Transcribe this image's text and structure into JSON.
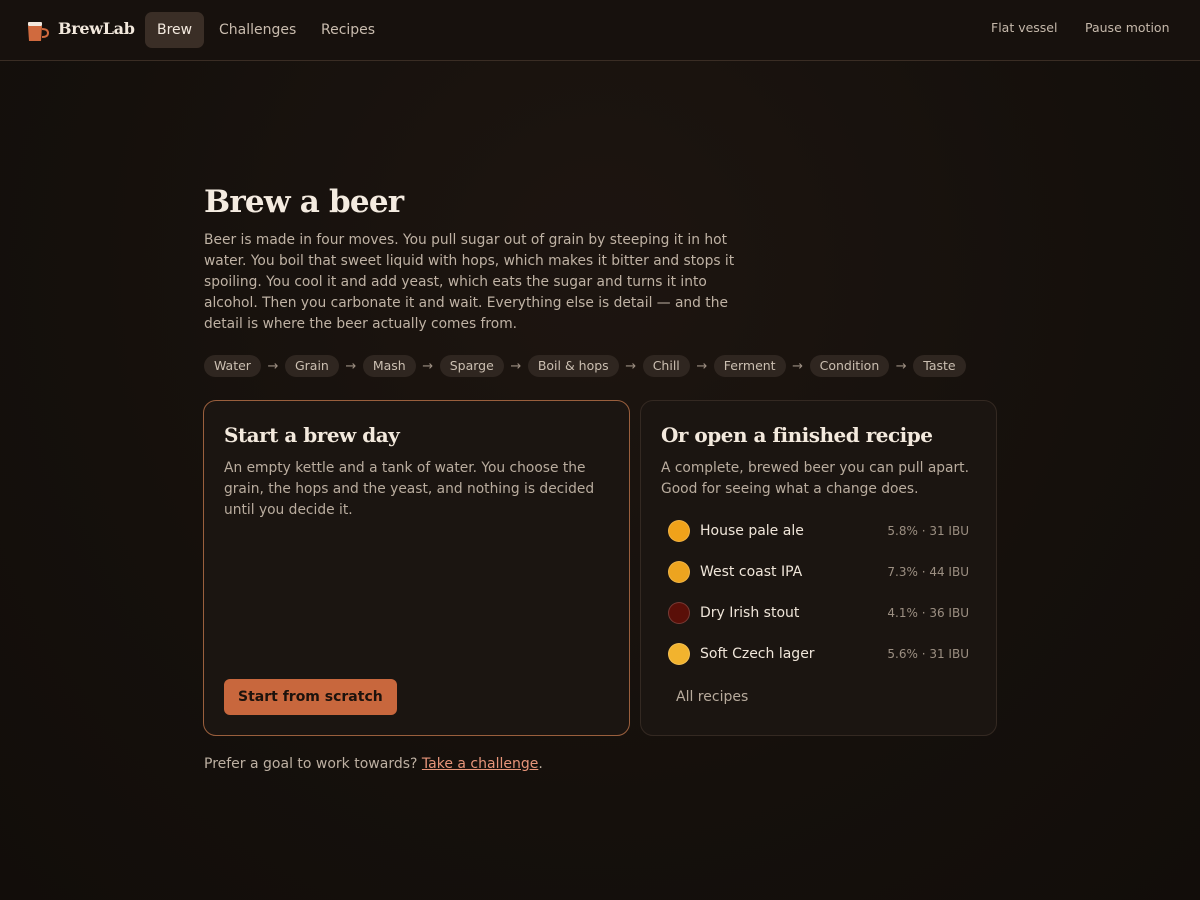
{
  "header": {
    "brand": "BrewLab",
    "tabs": [
      {
        "label": "Brew",
        "active": true
      },
      {
        "label": "Challenges",
        "active": false
      },
      {
        "label": "Recipes",
        "active": false
      }
    ],
    "actions": {
      "flat_vessel": "Flat vessel",
      "pause_motion": "Pause motion"
    }
  },
  "hero": {
    "title": "Brew a beer",
    "description": "Beer is made in four moves. You pull sugar out of grain by steeping it in hot water. You boil that sweet liquid with hops, which makes it bitter and stops it spoiling. You cool it and add yeast, which eats the sugar and turns it into alcohol. Then you carbonate it and wait. Everything else is detail — and the detail is where the beer actually comes from.",
    "steps": [
      "Water",
      "Grain",
      "Mash",
      "Sparge",
      "Boil & hops",
      "Chill",
      "Ferment",
      "Condition",
      "Taste"
    ],
    "arrow": "→"
  },
  "start_card": {
    "title": "Start a brew day",
    "description": "An empty kettle and a tank of water. You choose the grain, the hops and the yeast, and nothing is decided until you decide it.",
    "button": "Start from scratch"
  },
  "recipe_card": {
    "title": "Or open a finished recipe",
    "description": "A complete, brewed beer you can pull apart. Good for seeing what a change does.",
    "recipes": [
      {
        "name": "House pale ale",
        "meta": "5.8% · 31 IBU",
        "color": "#f0a21a"
      },
      {
        "name": "West coast IPA",
        "meta": "7.3% · 44 IBU",
        "color": "#eda41f"
      },
      {
        "name": "Dry Irish stout",
        "meta": "4.1% · 36 IBU",
        "color": "#5a0f08"
      },
      {
        "name": "Soft Czech lager",
        "meta": "5.6% · 31 IBU",
        "color": "#f2b32e"
      }
    ],
    "all_link": "All recipes"
  },
  "footer": {
    "prompt": "Prefer a goal to work towards? ",
    "link": "Take a challenge",
    "end": "."
  },
  "colors": {
    "accent": "#c8673d",
    "link": "#e8957a",
    "background": "#15100c"
  },
  "icons": {
    "logo": "beer-mug-icon"
  }
}
